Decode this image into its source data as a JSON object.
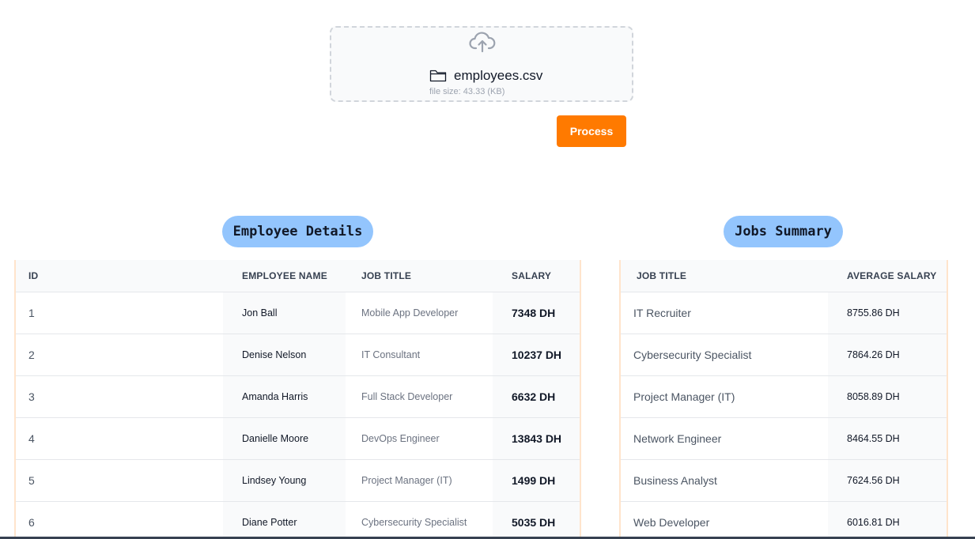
{
  "upload": {
    "file_name": "employees.csv",
    "file_size": "file size: 43.33 (KB)",
    "process_label": "Process"
  },
  "employees": {
    "heading": "Employee Details",
    "columns": [
      "ID",
      "EMPLOYEE NAME",
      "JOB TITLE",
      "SALARY"
    ],
    "rows": [
      {
        "id": "1",
        "name": "Jon Ball",
        "job": "Mobile App Developer",
        "salary": "7348 DH"
      },
      {
        "id": "2",
        "name": "Denise Nelson",
        "job": "IT Consultant",
        "salary": "10237 DH"
      },
      {
        "id": "3",
        "name": "Amanda Harris",
        "job": "Full Stack Developer",
        "salary": "6632 DH"
      },
      {
        "id": "4",
        "name": "Danielle Moore",
        "job": "DevOps Engineer",
        "salary": "13843 DH"
      },
      {
        "id": "5",
        "name": "Lindsey Young",
        "job": "Project Manager (IT)",
        "salary": "1499 DH"
      },
      {
        "id": "6",
        "name": "Diane Potter",
        "job": "Cybersecurity Specialist",
        "salary": "5035 DH"
      }
    ]
  },
  "jobs": {
    "heading": "Jobs Summary",
    "columns": [
      "JOB TITLE",
      "AVERAGE SALARY"
    ],
    "rows": [
      {
        "title": "IT Recruiter",
        "avg": "8755.86 DH"
      },
      {
        "title": "Cybersecurity Specialist",
        "avg": "7864.26 DH"
      },
      {
        "title": "Project Manager (IT)",
        "avg": "8058.89 DH"
      },
      {
        "title": "Network Engineer",
        "avg": "8464.55 DH"
      },
      {
        "title": "Business Analyst",
        "avg": "7624.56 DH"
      },
      {
        "title": "Web Developer",
        "avg": "6016.81 DH"
      }
    ]
  },
  "colors": {
    "accent": "#ff7a00",
    "pill": "#93c5fd"
  },
  "icons": [
    "cloud-upload-icon",
    "folder-icon"
  ]
}
